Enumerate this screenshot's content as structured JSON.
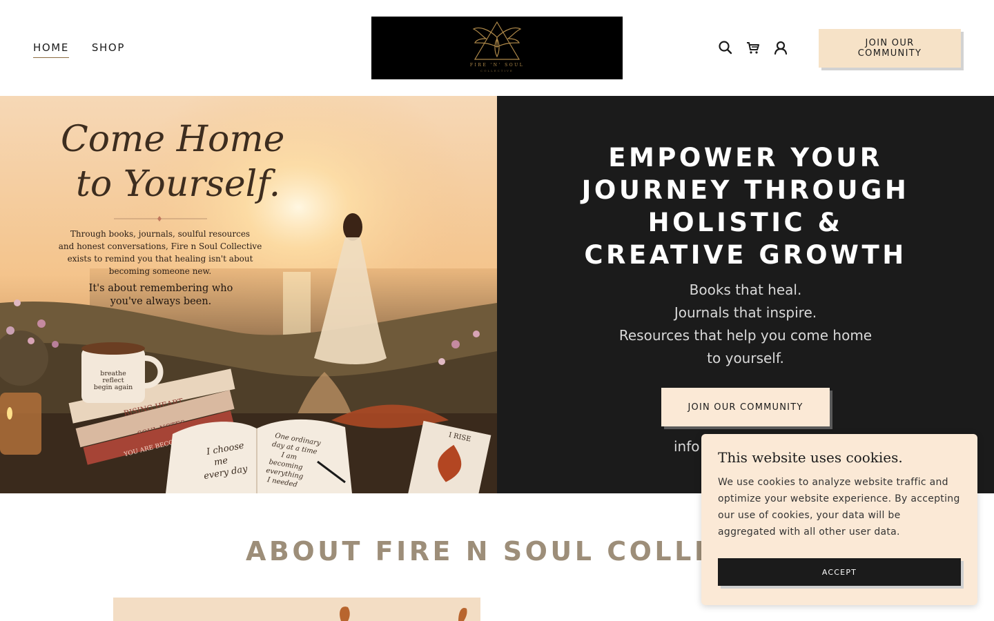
{
  "header": {
    "nav": [
      {
        "label": "HOME",
        "active": true
      },
      {
        "label": "SHOP",
        "active": false
      }
    ],
    "logo": {
      "text": "FIRE 'N' SOUL",
      "subtext": "COLLECTIVE"
    },
    "icons": [
      "search-icon",
      "cart-icon",
      "account-icon"
    ],
    "join_button": "JOIN OUR COMMUNITY"
  },
  "hero": {
    "image": {
      "script_line1": "Come Home",
      "script_line2": "to Yourself.",
      "intro_lines": [
        "Through books, journals, soulful resources",
        "and honest conversations, Fire n Soul Collective",
        "exists to remind you that healing isn't about",
        "becoming someone new."
      ],
      "emphasis_lines": [
        "It's about remembering who",
        "you've always been."
      ],
      "mug_lines": [
        "breathe",
        "reflect",
        "begin again"
      ],
      "book_titles": [
        "RISING HEART",
        "SOUL NOTES",
        "YOU ARE BECOMING"
      ],
      "journal_left": [
        "I choose",
        "me",
        "every day"
      ],
      "journal_right": [
        "One ordinary",
        "day at a time",
        "I am",
        "becoming",
        "everything",
        "I needed"
      ],
      "card_text": "I RISE"
    },
    "title_lines": [
      "EMPOWER YOUR",
      "JOURNEY THROUGH",
      "HOLISTIC &",
      "CREATIVE GROWTH"
    ],
    "subtitle_lines": [
      "Books that heal.",
      "Journals that inspire.",
      "Resources that help you come home",
      "to yourself."
    ],
    "cta": "JOIN OUR COMMUNITY",
    "email_partial": "info"
  },
  "about": {
    "title": "ABOUT FIRE N SOUL COLLECT"
  },
  "cookie": {
    "title": "This website uses cookies.",
    "text": "We use cookies to analyze website traffic and optimize your website experience. By accepting our use of cookies, your data will be aggregated with all other user data.",
    "accept": "ACCEPT"
  },
  "colors": {
    "accent_cream": "#f6e2c7",
    "dark": "#1b1b1b",
    "about_title": "#9d8e79",
    "logo_gold": "#b08a4a"
  }
}
